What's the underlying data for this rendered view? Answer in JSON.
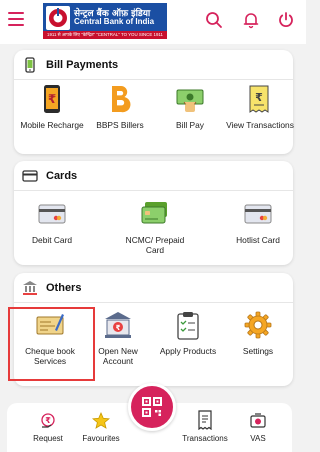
{
  "header": {
    "logo_hindi": "सेन्ट्रल बैंक ऑफ़ इंडिया",
    "logo_name": "Central Bank of India",
    "logo_tagline": "1911 से आपके लिए \"केन्द्रित\"  \"CENTRAL\" TO YOU SINCE 1911",
    "brand_color": "#d6235c"
  },
  "sections": [
    {
      "title": "Bill Payments",
      "items": [
        {
          "label": "Mobile Recharge",
          "icon": "mobile-recharge-icon"
        },
        {
          "label": "BBPS Billers",
          "icon": "bbps-icon"
        },
        {
          "label": "Bill Pay",
          "icon": "bill-pay-icon"
        },
        {
          "label": "View Transactions",
          "icon": "view-transactions-icon"
        }
      ]
    },
    {
      "title": "Cards",
      "items": [
        {
          "label": "Debit Card",
          "icon": "debit-card-icon"
        },
        {
          "label": "NCMC/ Prepaid Card",
          "icon": "prepaid-card-icon"
        },
        {
          "label": "Hotlist Card",
          "icon": "hotlist-card-icon"
        }
      ]
    },
    {
      "title": "Others",
      "items": [
        {
          "label": "Cheque book Services",
          "icon": "cheque-book-icon"
        },
        {
          "label": "Open New Account",
          "icon": "bank-icon"
        },
        {
          "label": "Apply Products",
          "icon": "clipboard-icon"
        },
        {
          "label": "Settings",
          "icon": "gear-icon"
        }
      ]
    }
  ],
  "bottom_nav": [
    {
      "label": "Request",
      "icon": "request-icon"
    },
    {
      "label": "Favourites",
      "icon": "star-icon"
    },
    {
      "label": "Transactions",
      "icon": "receipt-icon"
    },
    {
      "label": "VAS",
      "icon": "vas-icon"
    }
  ]
}
